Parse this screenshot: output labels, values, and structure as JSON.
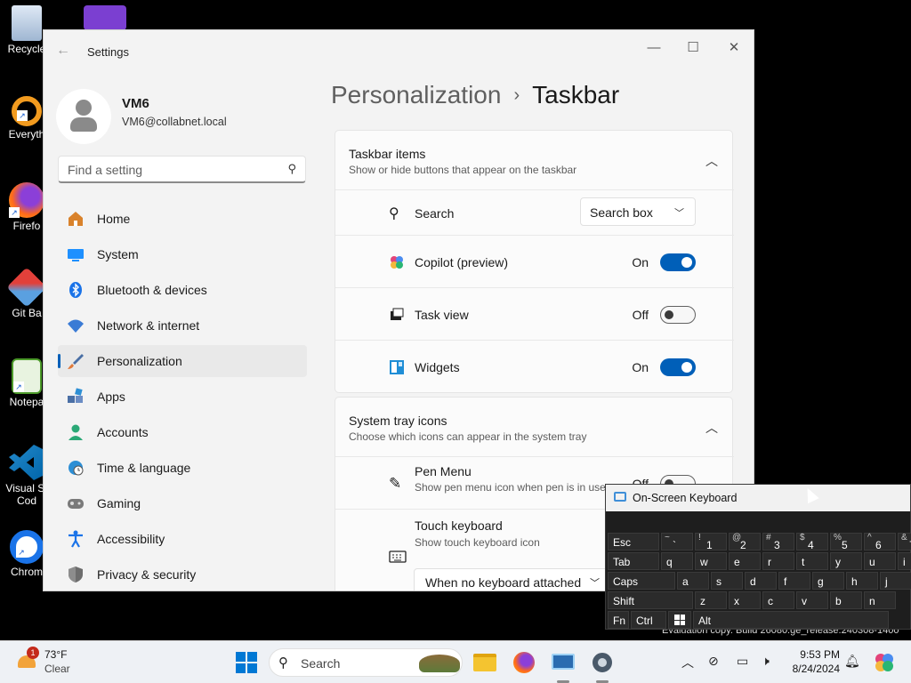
{
  "desktop": {
    "icons": [
      {
        "label": "Recycle",
        "icon": "recycle-bin-icon"
      },
      {
        "label": "Everyth",
        "icon": "everything-search-icon"
      },
      {
        "label": "Firefo",
        "icon": "firefox-icon"
      },
      {
        "label": "Git Ba",
        "icon": "git-bash-icon"
      },
      {
        "label": "Notepa",
        "icon": "notepad-icon"
      },
      {
        "label": "Visual St",
        "label2": "Cod",
        "icon": "vscode-icon"
      },
      {
        "label": "Chrom",
        "icon": "chrome-icon"
      }
    ]
  },
  "settings": {
    "title": "Settings",
    "user": {
      "name": "VM6",
      "email": "VM6@collabnet.local"
    },
    "search_placeholder": "Find a setting",
    "nav": [
      {
        "label": "Home",
        "icon": "home-icon",
        "color": "#d9822b"
      },
      {
        "label": "System",
        "icon": "system-icon",
        "color": "#1e90ff"
      },
      {
        "label": "Bluetooth & devices",
        "icon": "bluetooth-icon",
        "color": "#1a73e8"
      },
      {
        "label": "Network & internet",
        "icon": "wifi-icon",
        "color": "#3a7bd5"
      },
      {
        "label": "Personalization",
        "icon": "brush-icon",
        "color": "#e07a3b",
        "selected": true
      },
      {
        "label": "Apps",
        "icon": "apps-icon",
        "color": "#4a6fa5"
      },
      {
        "label": "Accounts",
        "icon": "accounts-icon",
        "color": "#2aa876"
      },
      {
        "label": "Time & language",
        "icon": "globe-clock-icon",
        "color": "#2d8fd5"
      },
      {
        "label": "Gaming",
        "icon": "gamepad-icon",
        "color": "#7a7a7a"
      },
      {
        "label": "Accessibility",
        "icon": "accessibility-icon",
        "color": "#1a73e8"
      },
      {
        "label": "Privacy & security",
        "icon": "shield-icon",
        "color": "#6d6d6d"
      }
    ],
    "breadcrumb": {
      "parent": "Personalization",
      "separator": "›",
      "current": "Taskbar"
    },
    "taskbar_items": {
      "header": "Taskbar items",
      "subtitle": "Show or hide buttons that appear on the taskbar",
      "rows": {
        "search": {
          "label": "Search",
          "value": "Search box"
        },
        "copilot": {
          "label": "Copilot (preview)",
          "state": "On",
          "on": true
        },
        "taskview": {
          "label": "Task view",
          "state": "Off",
          "on": false
        },
        "widgets": {
          "label": "Widgets",
          "state": "On",
          "on": true
        }
      }
    },
    "system_tray": {
      "header": "System tray icons",
      "subtitle": "Choose which icons can appear in the system tray",
      "pen": {
        "label": "Pen Menu",
        "sub": "Show pen menu icon when pen is in use",
        "state": "Off"
      },
      "touch": {
        "label": "Touch keyboard",
        "sub": "Show touch keyboard icon",
        "value": "When no keyboard attached"
      }
    }
  },
  "osk": {
    "title": "On-Screen Keyboard",
    "rows": [
      [
        {
          "m": "Esc"
        },
        {
          "s": "~",
          "n": "`"
        },
        {
          "s": "!",
          "n": "1"
        },
        {
          "s": "@",
          "n": "2"
        },
        {
          "s": "#",
          "n": "3"
        },
        {
          "s": "$",
          "n": "4"
        },
        {
          "s": "%",
          "n": "5"
        },
        {
          "s": "^",
          "n": "6"
        },
        {
          "s": "&",
          "n": "7"
        }
      ],
      [
        {
          "m": "Tab"
        },
        {
          "m": "q"
        },
        {
          "m": "w"
        },
        {
          "m": "e"
        },
        {
          "m": "r"
        },
        {
          "m": "t"
        },
        {
          "m": "y"
        },
        {
          "m": "u"
        },
        {
          "m": "i"
        }
      ],
      [
        {
          "m": "Caps"
        },
        {
          "m": "a"
        },
        {
          "m": "s"
        },
        {
          "m": "d"
        },
        {
          "m": "f"
        },
        {
          "m": "g"
        },
        {
          "m": "h"
        },
        {
          "m": "j"
        }
      ],
      [
        {
          "m": "Shift"
        },
        {
          "m": "z"
        },
        {
          "m": "x"
        },
        {
          "m": "c"
        },
        {
          "m": "v"
        },
        {
          "m": "b"
        },
        {
          "m": "n"
        }
      ],
      [
        {
          "m": "Fn"
        },
        {
          "m": "Ctrl"
        },
        {
          "m": ""
        },
        {
          "m": "Alt"
        }
      ]
    ]
  },
  "watermark": "Evaluation copy. Build 26080.ge_release.240308-1400",
  "taskbar": {
    "weather": {
      "badge": "1",
      "temp": "73°F",
      "cond": "Clear"
    },
    "search_label": "Search",
    "clock": {
      "time": "9:53 PM",
      "date": "8/24/2024"
    }
  }
}
